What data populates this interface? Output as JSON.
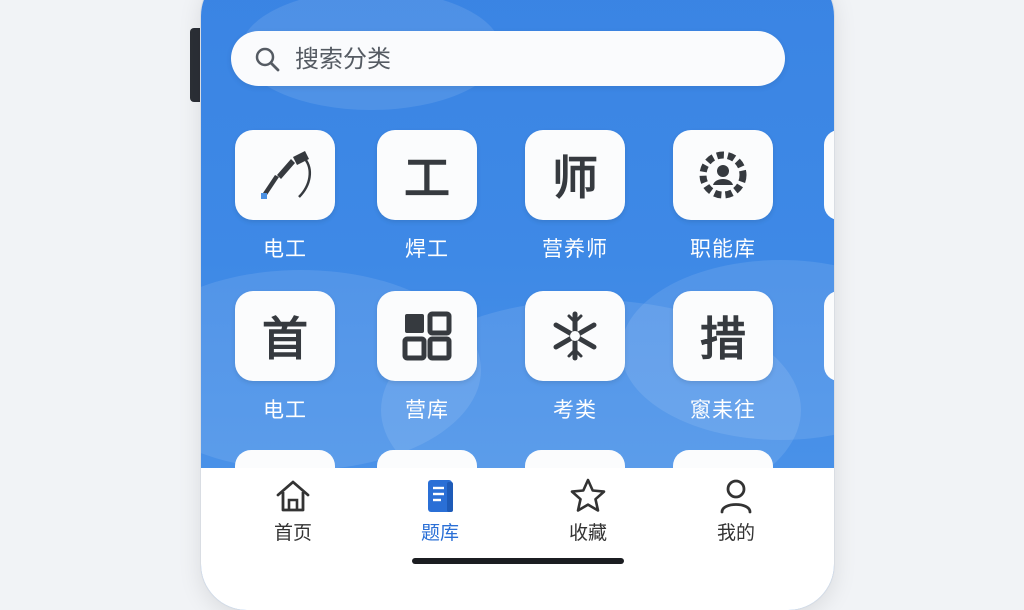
{
  "search": {
    "placeholder": "搜索分类"
  },
  "grid": {
    "row1": [
      {
        "label": "电工",
        "icon": "welding-torch-icon"
      },
      {
        "label": "焊工",
        "glyph": "工"
      },
      {
        "label": "营养师",
        "glyph": "师"
      },
      {
        "label": "职能库",
        "icon": "gear-user-icon"
      }
    ],
    "row2": [
      {
        "label": "电工",
        "glyph": "首"
      },
      {
        "label": "营库",
        "icon": "grid-icon"
      },
      {
        "label": "考类",
        "icon": "snowflake-icon"
      },
      {
        "label": "窻耒往",
        "glyph": "措"
      }
    ]
  },
  "tabbar": {
    "items": [
      {
        "label": "首页",
        "icon": "home-icon"
      },
      {
        "label": "题库",
        "icon": "book-icon",
        "active": true
      },
      {
        "label": "收藏",
        "icon": "star-icon"
      },
      {
        "label": "我的",
        "icon": "user-icon"
      }
    ]
  },
  "colors": {
    "background": "#3a84e3",
    "accent": "#2a6fd6",
    "tile": "#fbfcfd"
  }
}
